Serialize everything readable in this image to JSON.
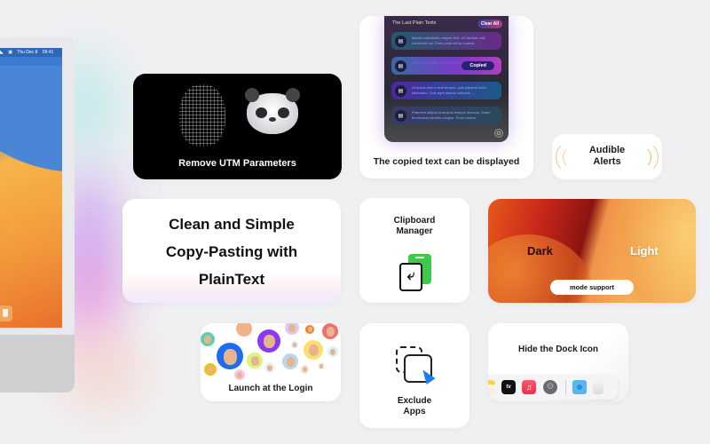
{
  "monitor": {
    "menubar_date": "Thu Dec 8",
    "menubar_time": "09:41",
    "dock_icons": [
      "trash-icon"
    ]
  },
  "cards": {
    "utm": {
      "title": "Remove UTM Parameters"
    },
    "copied": {
      "title": "The copied text can be displayed",
      "panel_header": "The Last Plain Texts",
      "clear_all_label": "Clear All",
      "items": [
        {
          "text": "Mauris sollicitudin magna velit, vel facilisis velit commodo vel. Proin porta elit ac massa ..."
        },
        {
          "text": "Nunc elementum velit. Integer mauris ...",
          "badge": "Copied"
        },
        {
          "text": "Ut luctus erat in erat tempor, quis placerat dolor bibendum. Duis eget mauris vehicula, ..."
        },
        {
          "text": "Praesent aliquet urna quis tempus rhoncus. Etiam fermentum lobortis congue. Proin viverra"
        }
      ]
    },
    "audible": {
      "title_line1": "Audible",
      "title_line2": "Alerts"
    },
    "clean": {
      "line1": "Clean and Simple",
      "line2": "Copy-Pasting with",
      "line3": "PlainText"
    },
    "clipboard": {
      "title_line1": "Clipboard",
      "title_line2": "Manager"
    },
    "mode": {
      "dark_label": "Dark",
      "light_label": "Light",
      "pill_label": "mode support"
    },
    "launch": {
      "title": "Launch at the Login"
    },
    "exclude": {
      "title_line1": "Exclude",
      "title_line2": "Apps"
    },
    "dock": {
      "title": "Hide the Dock Icon",
      "apps": [
        {
          "name": "notes-icon",
          "label": ""
        },
        {
          "name": "apple-tv-icon",
          "label": "tv"
        },
        {
          "name": "music-icon",
          "label": "♫"
        },
        {
          "name": "system-settings-icon",
          "label": "⚙"
        },
        {
          "name": "downloads-folder-icon",
          "label": ""
        },
        {
          "name": "trash-icon",
          "label": ""
        }
      ]
    }
  },
  "colors": {
    "background": "#f0f0f2",
    "card": "#ffffff",
    "accent_green": "#3ec94a",
    "accent_blue": "#1d7cf2",
    "audible_orange": "#f5b56a"
  }
}
